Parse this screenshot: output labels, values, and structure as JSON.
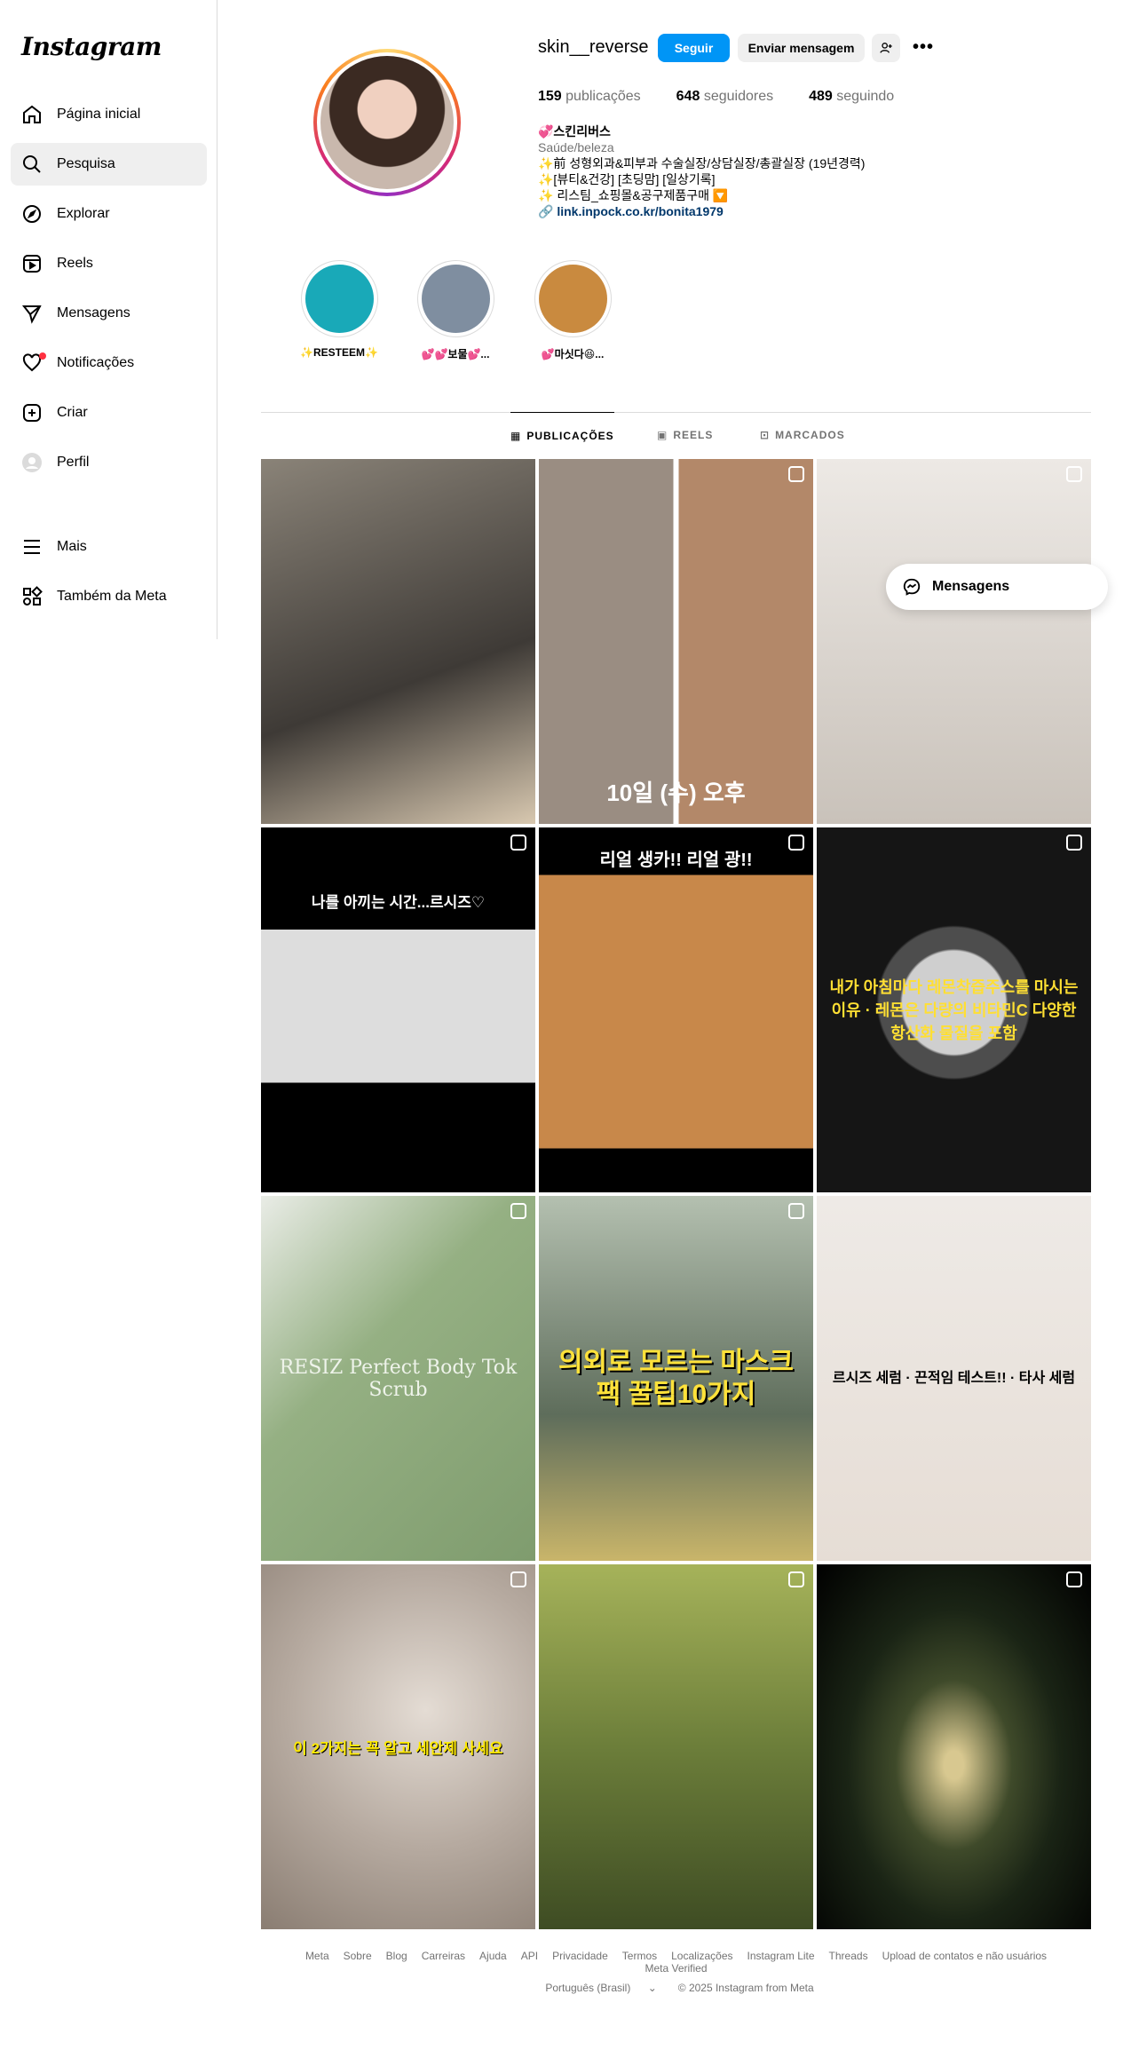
{
  "sidebar": {
    "logo": "Instagram",
    "items": [
      {
        "label": "Página inicial",
        "icon": "home-icon"
      },
      {
        "label": "Pesquisa",
        "icon": "search-icon"
      },
      {
        "label": "Explorar",
        "icon": "compass-icon"
      },
      {
        "label": "Reels",
        "icon": "reels-icon"
      },
      {
        "label": "Mensagens",
        "icon": "send-icon"
      },
      {
        "label": "Notificações",
        "icon": "heart-icon"
      },
      {
        "label": "Criar",
        "icon": "plus-icon"
      },
      {
        "label": "Perfil",
        "icon": "avatar-icon"
      }
    ],
    "bottom": [
      {
        "label": "Mais",
        "icon": "menu-icon"
      },
      {
        "label": "Também da Meta",
        "icon": "meta-apps-icon"
      }
    ]
  },
  "profile": {
    "username": "skin__reverse",
    "follow_label": "Seguir",
    "message_label": "Enviar mensagem",
    "stats": {
      "posts_count": "159",
      "posts_label": "publicações",
      "followers_count": "648",
      "followers_label": "seguidores",
      "following_count": "489",
      "following_label": "seguindo"
    },
    "bio": {
      "name": "💞스킨리버스",
      "category": "Saúde/beleza",
      "line1": "✨前 성형외과&피부과 수술실장/상담실장/총괄실장 (19년경력)",
      "line2": "✨[뷰티&건강] [초딩맘] [일상기록]",
      "line3": "✨ 리스팀_쇼핑몰&공구제품구매 🔽",
      "link": "link.inpock.co.kr/bonita1979"
    }
  },
  "highlights": [
    {
      "label": "✨RESTEEM✨",
      "color": "#19a9b8"
    },
    {
      "label": "💕💕보물💕...",
      "color": "#7f8ea0"
    },
    {
      "label": "💕마싯다😆...",
      "color": "#c98a3f"
    }
  ],
  "tabs": [
    {
      "label": "PUBLICAÇÕES",
      "icon": "grid-icon"
    },
    {
      "label": "REELS",
      "icon": "reels-icon"
    },
    {
      "label": "MARCADOS",
      "icon": "tagged-icon"
    }
  ],
  "posts": [
    {
      "bg": "#5e5a55",
      "text": "",
      "reel": false
    },
    {
      "bg": "#7a6a5e",
      "text": "10일 (수) 오후",
      "reel": true
    },
    {
      "bg": "#d8d2cc",
      "text": "",
      "reel": true
    },
    {
      "bg": "#111111",
      "text": "나를 아끼는 시간...르시즈♡",
      "reel": true
    },
    {
      "bg": "#c8884a",
      "text": "리얼 생카!! 리얼 광!!",
      "reel": true
    },
    {
      "bg": "#151515",
      "text": "내가 아침마다 레몬착즙주스를 마시는 이유 · 레몬은 다량의 비타민C 다양한 항산화 물질을 포함",
      "reel": true
    },
    {
      "bg": "#95b083",
      "text": "RESIZ Perfect Body Tok Scrub",
      "reel": true
    },
    {
      "bg": "#7d8a7a",
      "text": "의외로 모르는 마스크팩 꿀팁10가지",
      "reel": true
    },
    {
      "bg": "#eeeae6",
      "text": "르시즈 세럼 · 끈적임 테스트!! · 타사 세럼",
      "reel": false
    },
    {
      "bg": "#b6aaa0",
      "text": "이 2가지는 꼭 알고 세안제 사세요",
      "reel": true
    },
    {
      "bg": "#6c7e3a",
      "text": "",
      "reel": true
    },
    {
      "bg": "#1a2415",
      "text": "",
      "reel": true
    }
  ],
  "floating": {
    "label": "Mensagens"
  },
  "footer": {
    "links": [
      "Meta",
      "Sobre",
      "Blog",
      "Carreiras",
      "Ajuda",
      "API",
      "Privacidade",
      "Termos",
      "Localizações",
      "Instagram Lite",
      "Threads",
      "Upload de contatos e não usuários",
      "Meta Verified"
    ],
    "language": "Português (Brasil)",
    "copyright": "© 2025 Instagram from Meta"
  },
  "colors": {
    "accent": "#0095f6",
    "link": "#00376b",
    "notification": "#ff3040"
  }
}
